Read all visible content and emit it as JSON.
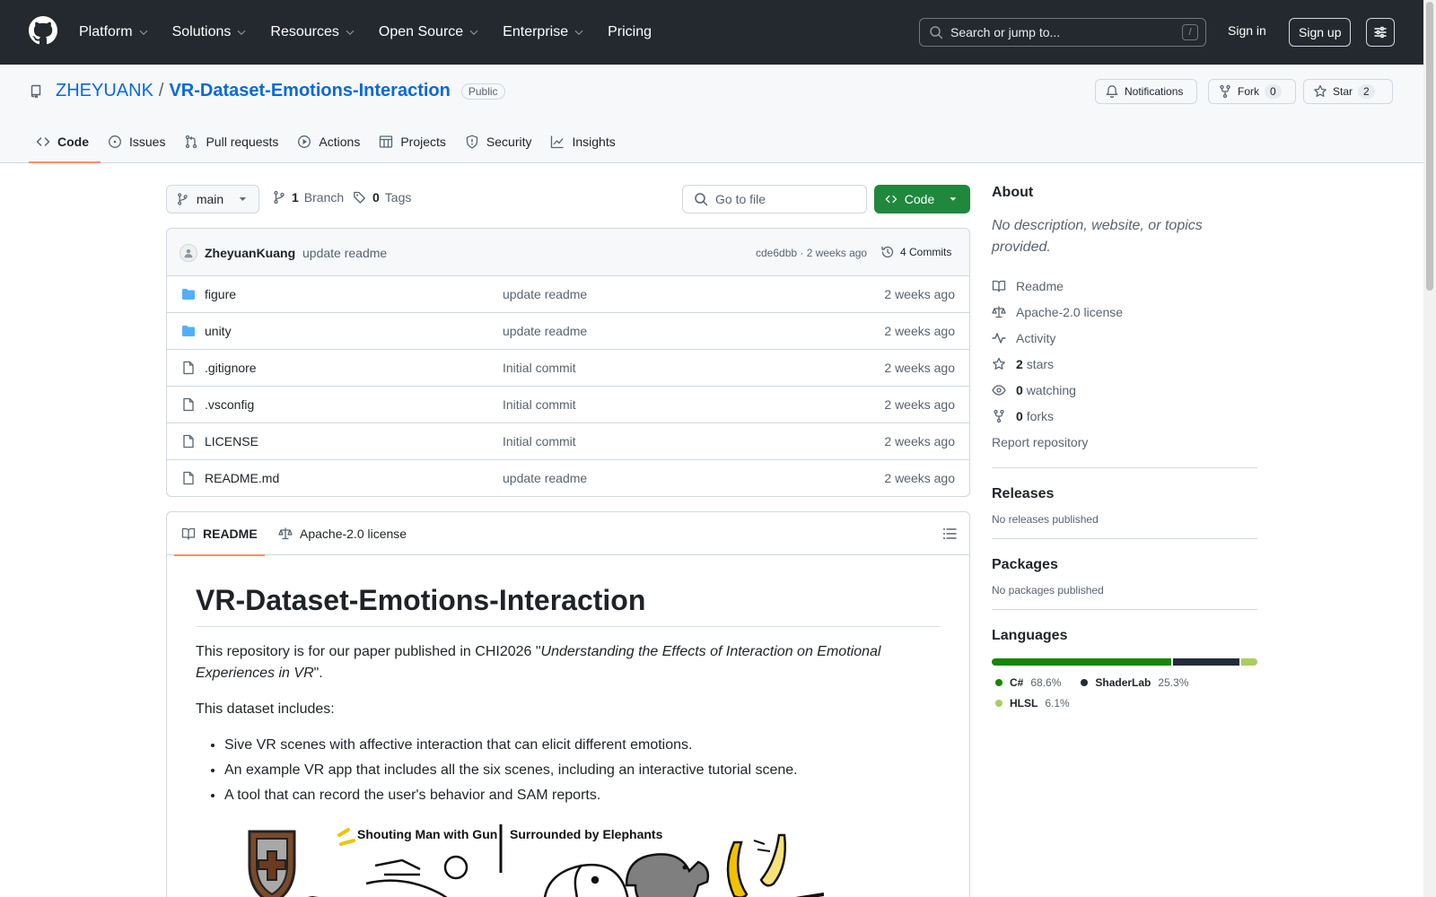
{
  "header": {
    "nav": [
      {
        "label": "Platform",
        "dropdown": true
      },
      {
        "label": "Solutions",
        "dropdown": true
      },
      {
        "label": "Resources",
        "dropdown": true
      },
      {
        "label": "Open Source",
        "dropdown": true
      },
      {
        "label": "Enterprise",
        "dropdown": true
      },
      {
        "label": "Pricing",
        "dropdown": false
      }
    ],
    "search_placeholder": "Search or jump to...",
    "search_shortcut": "/",
    "signin": "Sign in",
    "signup": "Sign up"
  },
  "repo": {
    "owner": "ZHEYUANK",
    "separator": "/",
    "name": "VR-Dataset-Emotions-Interaction",
    "visibility": "Public",
    "notifications_label": "Notifications",
    "fork_label": "Fork",
    "fork_count": "0",
    "star_label": "Star",
    "star_count": "2",
    "tabs": [
      "Code",
      "Issues",
      "Pull requests",
      "Actions",
      "Projects",
      "Security",
      "Insights"
    ]
  },
  "toolbar": {
    "branch": "main",
    "branch_count": "1",
    "branch_label": "Branch",
    "tag_count": "0",
    "tag_label": "Tags",
    "goto_placeholder": "Go to file",
    "code_label": "Code"
  },
  "commit": {
    "author": "ZheyuanKuang",
    "message": "update readme",
    "meta": "cde6dbb · 2 weeks ago",
    "commits": "4 Commits"
  },
  "files": [
    {
      "name": "figure",
      "type": "dir",
      "commit": "update readme",
      "date": "2 weeks ago"
    },
    {
      "name": "unity",
      "type": "dir",
      "commit": "update readme",
      "date": "2 weeks ago"
    },
    {
      "name": ".gitignore",
      "type": "file",
      "commit": "Initial commit",
      "date": "2 weeks ago"
    },
    {
      "name": ".vsconfig",
      "type": "file",
      "commit": "Initial commit",
      "date": "2 weeks ago"
    },
    {
      "name": "LICENSE",
      "type": "file",
      "commit": "Initial commit",
      "date": "2 weeks ago"
    },
    {
      "name": "README.md",
      "type": "file",
      "commit": "update readme",
      "date": "2 weeks ago"
    }
  ],
  "readme": {
    "tab_readme": "README",
    "tab_license": "Apache-2.0 license",
    "title": "VR-Dataset-Emotions-Interaction",
    "intro_prefix": "This repository is for our paper published in CHI2026 \"",
    "intro_italic": "Understanding the Effects of Interaction on Emotional Experiences in VR",
    "intro_suffix": "\".",
    "includes": "This dataset includes:",
    "bullets": [
      "Sive VR scenes with affective interaction that can elicit different emotions.",
      "An example VR app that includes all the six scenes, including an interactive tutorial scene.",
      "A tool that can record the user's behavior and SAM reports."
    ],
    "figure_labels": [
      "Shouting Man with Gun",
      "Surrounded by Elephants"
    ]
  },
  "sidebar": {
    "about_title": "About",
    "about_desc": "No description, website, or topics provided.",
    "links": [
      {
        "icon": "book-icon",
        "strong": "",
        "text": "Readme"
      },
      {
        "icon": "law-icon",
        "strong": "",
        "text": "Apache-2.0 license"
      },
      {
        "icon": "pulse-icon",
        "strong": "",
        "text": "Activity"
      },
      {
        "icon": "star-icon",
        "strong": "2",
        "text": "stars"
      },
      {
        "icon": "eye-icon",
        "strong": "0",
        "text": "watching"
      },
      {
        "icon": "fork-icon",
        "strong": "0",
        "text": "forks"
      }
    ],
    "report": "Report repository",
    "releases_title": "Releases",
    "releases_empty": "No releases published",
    "packages_title": "Packages",
    "packages_empty": "No packages published",
    "languages_title": "Languages",
    "languages": [
      {
        "name": "C#",
        "pct": "68.6%",
        "value": 68.6,
        "color": "#178600"
      },
      {
        "name": "ShaderLab",
        "pct": "25.3%",
        "value": 25.3,
        "color": "#222c37"
      },
      {
        "name": "HLSL",
        "pct": "6.1%",
        "value": 6.1,
        "color": "#aace60"
      }
    ]
  }
}
